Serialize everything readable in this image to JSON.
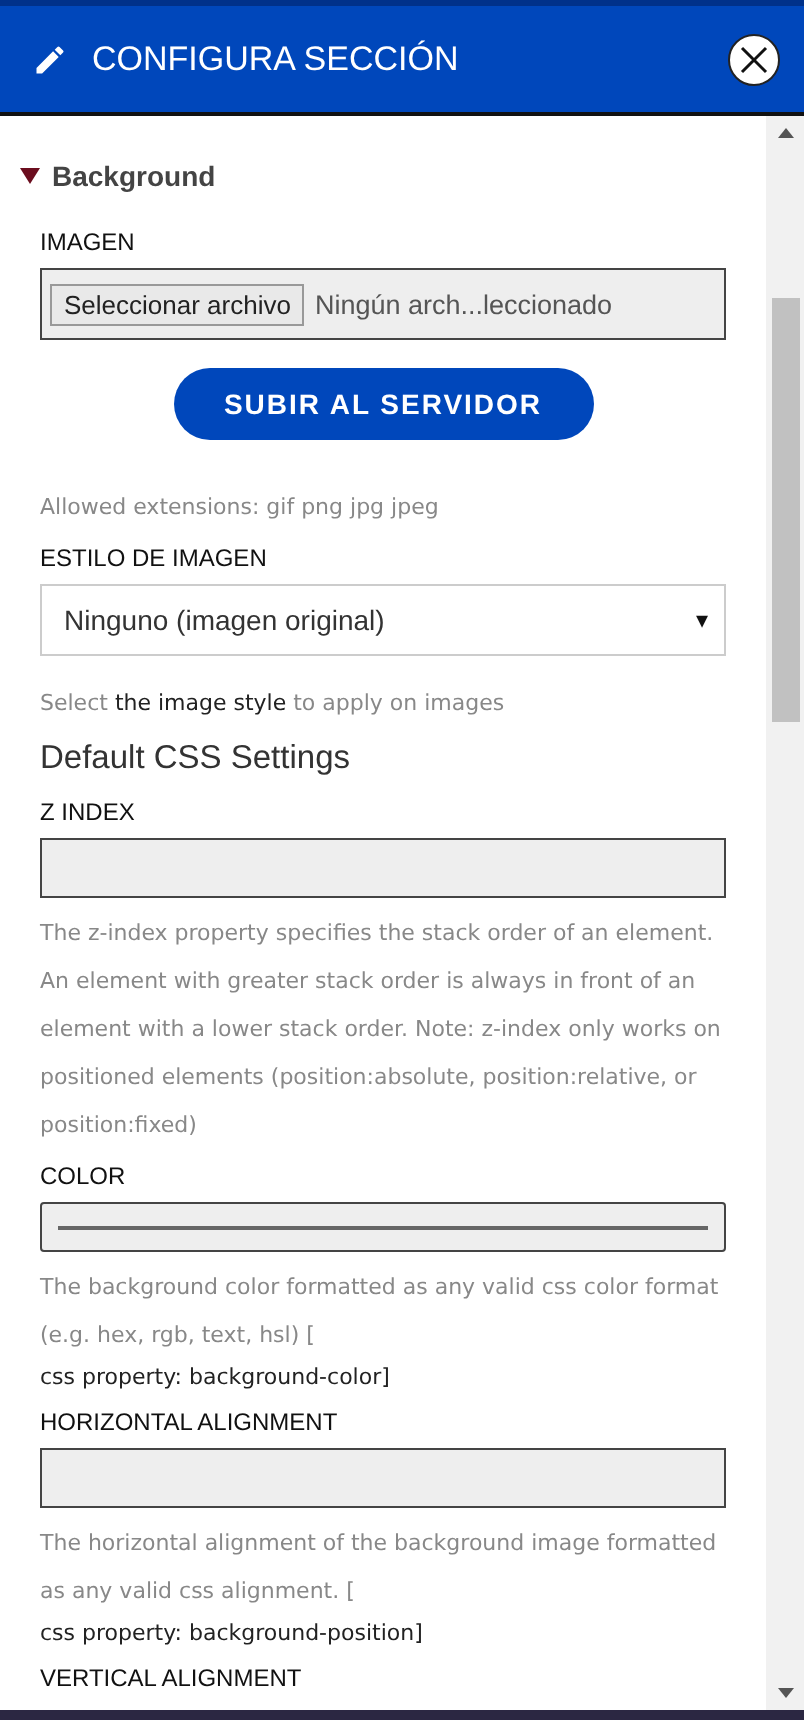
{
  "header": {
    "title": "CONFIGURA SECCIÓN"
  },
  "section": {
    "title": "Background",
    "expanded": true
  },
  "fields": [
    {
      "kind": "file",
      "label": "IMAGEN",
      "button": "Seleccionar archivo",
      "value": "Ningún arch...leccionado"
    },
    {
      "kind": "action",
      "button": "SUBIR AL SERVIDOR"
    },
    {
      "kind": "note",
      "help": [
        {
          "kind": "muted",
          "text": "Allowed extensions: gif png jpg jpeg"
        }
      ]
    },
    {
      "kind": "select",
      "label": "ESTILO DE IMAGEN",
      "value": "Ninguno (imagen original)",
      "caret": "▾",
      "help": [
        {
          "kind": "muted",
          "text": "Select "
        },
        {
          "kind": "plain",
          "text": "the image style"
        },
        {
          "kind": "muted",
          "text": " to apply on images"
        }
      ]
    },
    {
      "kind": "heading",
      "text": "Default CSS Settings"
    },
    {
      "kind": "text",
      "label": "Z INDEX",
      "help": [
        {
          "kind": "muted",
          "text": "The z-index property specifies the stack order of an element. An element with greater stack order is always in front of an element with a lower stack order. Note: z-index only works on positioned elements (position:absolute, position:relative, or position:fixed)"
        }
      ]
    },
    {
      "kind": "color",
      "label": "COLOR",
      "help": [
        {
          "kind": "muted",
          "text": "The background color formatted as any valid css color format (e.g. hex, rgb, text, hsl) ["
        },
        {
          "kind": "block",
          "text": "css property: background-color]"
        }
      ]
    },
    {
      "kind": "text",
      "label": "HORIZONTAL ALIGNMENT",
      "help": [
        {
          "kind": "muted",
          "text": "The horizontal alignment of the background image formatted as any valid css alignment. ["
        },
        {
          "kind": "block",
          "text": "css property: background-position]"
        }
      ]
    },
    {
      "kind": "label",
      "label": "VERTICAL ALIGNMENT"
    }
  ]
}
